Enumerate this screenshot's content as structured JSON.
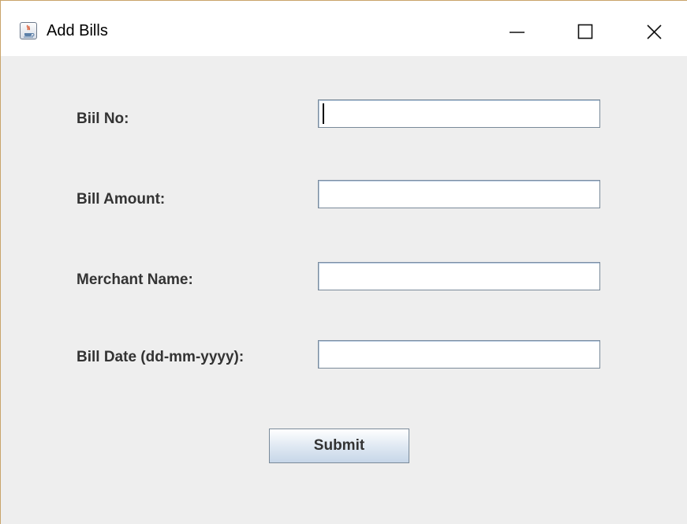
{
  "window": {
    "title": "Add Bills",
    "icon": "java-coffee-cup-icon",
    "controls": {
      "minimize": "minimize-icon",
      "maximize": "maximize-icon",
      "close": "close-icon"
    }
  },
  "form": {
    "fields": [
      {
        "label": "Biil No:",
        "value": ""
      },
      {
        "label": "Bill Amount:",
        "value": ""
      },
      {
        "label": "Merchant Name:",
        "value": ""
      },
      {
        "label": "Bill Date (dd-mm-yyyy):",
        "value": ""
      }
    ],
    "submit_label": "Submit"
  },
  "colors": {
    "background": "#eeeeee",
    "label_text": "#333333",
    "field_border": "#7a8a99",
    "button_gradient_bottom": "#c6d6e8"
  }
}
